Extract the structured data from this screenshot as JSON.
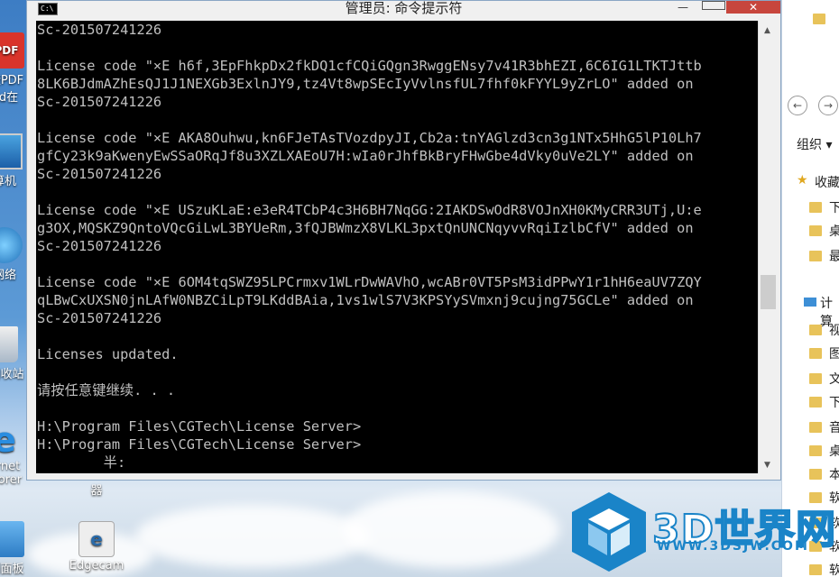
{
  "window": {
    "title": "管理员: 命令提示符",
    "system_icon": "C:\\",
    "min_glyph": "—",
    "close_glyph": "✕"
  },
  "console_lines": [
    "Sc-201507241226",
    "",
    "License code \"×E h6f,3EpFhkpDx2fkDQ1cfCQiGQgn3RwggENsy7v41R3bhEZI,6C6IG1LTKTJttb",
    "8LK6BJdmAZhEsQJ1J1NEXGb3ExlnJY9,tz4Vt8wpSEcIyVvlnsfUL7fhf0kFYYL9yZrLO\" added on",
    "Sc-201507241226",
    "",
    "License code \"×E AKA8Ouhwu,kn6FJeTAsTVozdpyJI,Cb2a:tnYAGlzd3cn3g1NTx5HhG5lP10Lh7",
    "gfCy23k9aKwenyEwSSaORqJf8u3XZLXAEoU7H:wIa0rJhfBkBryFHwGbe4dVky0uVe2LY\" added on",
    "Sc-201507241226",
    "",
    "License code \"×E USzuKLaE:e3eR4TCbP4c3H6BH7NqGG:2IAKDSwOdR8VOJnXH0KMyCRR3UTj,U:e",
    "g3OX,MQSKZ9QntoVQcGiLwL3BYUeRm,3fQJBWmzX8VLKL3pxtQnUNCNqyvvRqiIzlbCfV\" added on",
    "Sc-201507241226",
    "",
    "License code \"×E 6OM4tqSWZ95LPCrmxv1WLrDwWAVhO,wcABr0VT5PsM3idPPwY1r1hH6eaUV7ZQY",
    "qLBwCxUXSN0jnLAfW0NBZCiLpT9LKddBAia,1vs1wlS7V3KPSYySVmxnj9cujng75GCLe\" added on",
    "Sc-201507241226",
    "",
    "Licenses updated.",
    "",
    "请按任意键继续. . .",
    "",
    "H:\\Program Files\\CGTech\\License Server>",
    "H:\\Program Files\\CGTech\\License Server>",
    "        半:"
  ],
  "desktop_icons": [
    {
      "label": "捷PDF",
      "label2": "rd在"
    },
    {
      "label": "算机"
    },
    {
      "label": "网络"
    },
    {
      "label": "回收站"
    },
    {
      "label": "ernet",
      "label2": "plorer"
    },
    {
      "label": "器"
    },
    {
      "label": "制面板"
    },
    {
      "label": "Edgecam"
    }
  ],
  "explorer": {
    "organize": "组织 ▾",
    "favorites": "收藏",
    "computer": "计算",
    "items": [
      "下",
      "桌",
      "最",
      "视",
      "图",
      "文",
      "下",
      "音",
      "桌",
      "本",
      "软",
      "软",
      "软",
      "软"
    ]
  },
  "watermark": {
    "text": "3D世界网",
    "url": "WWW.3DSJW.COM"
  }
}
